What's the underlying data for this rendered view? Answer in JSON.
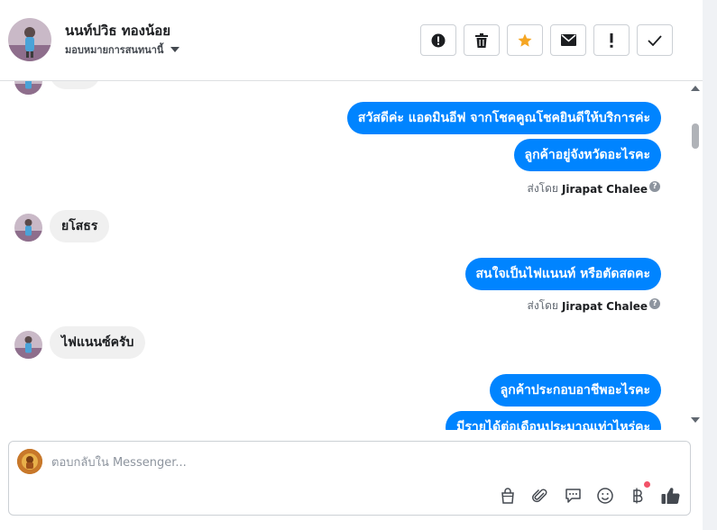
{
  "header": {
    "contact_name": "นนท์ปวิธ ทองน้อย",
    "assign_label": "มอบหมายการสนทนานี้",
    "buttons": [
      {
        "name": "spam-button",
        "icon": "alert-circle-icon"
      },
      {
        "name": "delete-button",
        "icon": "trash-icon"
      },
      {
        "name": "star-button",
        "icon": "star-icon",
        "color": "#f5a623"
      },
      {
        "name": "mark-unread-button",
        "icon": "envelope-icon"
      },
      {
        "name": "follow-up-button",
        "icon": "exclamation-icon"
      },
      {
        "name": "mark-done-button",
        "icon": "check-icon"
      }
    ]
  },
  "messages": [
    {
      "type": "out",
      "text": "สวัสดีค่ะ แอดมินอีฟ จากโชคคูณโชคยินดีให้บริการค่ะ"
    },
    {
      "type": "out",
      "text": "ลูกค้าอยู่จังหวัดอะไรคะ"
    },
    {
      "type": "sent_by",
      "prefix": "ส่งโดย",
      "name": "Jirapat Chalee"
    },
    {
      "type": "in",
      "text": "ยโสธร"
    },
    {
      "type": "out",
      "text": "สนใจเป็นไฟแนนท์ หรือตัดสดคะ"
    },
    {
      "type": "sent_by",
      "prefix": "ส่งโดย",
      "name": "Jirapat Chalee"
    },
    {
      "type": "in",
      "text": "ไฟแนนซ์ครับ"
    },
    {
      "type": "out",
      "text": "ลูกค้าประกอบอาชีพอะไรคะ"
    },
    {
      "type": "out",
      "text": "มีรายได้ต่อเดือนประมาณเท่าไหร่คะ"
    }
  ],
  "composer": {
    "placeholder": "ตอบกลับใน Messenger...",
    "tools": [
      "shopping-bag-icon",
      "paperclip-icon",
      "chat-bubble-icon",
      "smiley-icon",
      "baht-icon",
      "thumbs-up-icon"
    ]
  },
  "colors": {
    "outgoing_bubble": "#0084ff",
    "incoming_bubble": "#f0f0f0",
    "star": "#f5a623",
    "notification_dot": "#f25268"
  }
}
